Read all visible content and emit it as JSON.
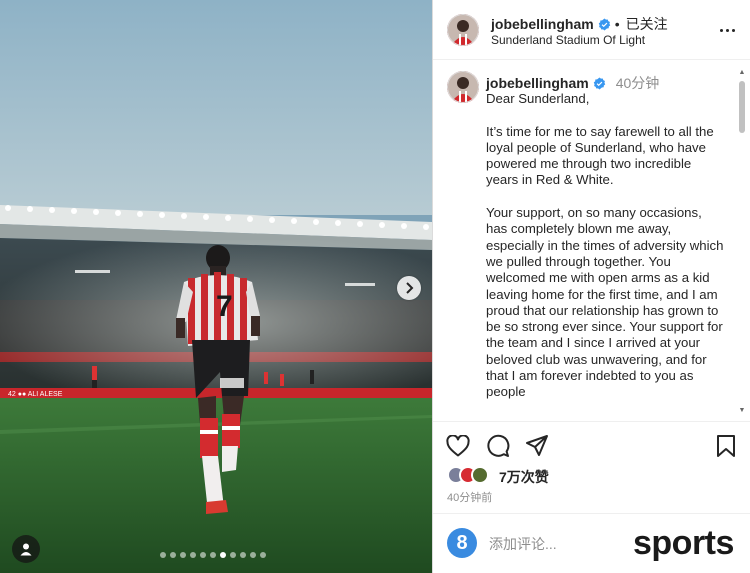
{
  "post": {
    "username": "jobebellingham",
    "follow_status": "已关注",
    "location": "Sunderland Stadium Of Light",
    "time_ago": "40分钟",
    "caption": {
      "greeting": "Dear Sunderland,",
      "paragraph_1": "It’s time for me to say farewell to all the loyal people of Sunderland, who have powered me through two incredible years in Red & White.",
      "paragraph_2": "Your support, on so many occasions, has completely blown me away, especially in the times of adversity which we pulled through together. You welcomed me with open arms as a kid leaving home for the first time, and I am proud that our relationship has grown to be so strong ever since. Your support for the team and I since I arrived at your beloved club was unwavering, and for that I am forever indebted to you as people"
    },
    "likes": "7万次赞",
    "posted": "40分钟前",
    "comment_placeholder": "添加评论...",
    "watermark": "sports"
  },
  "media": {
    "board_text": "42 ●● ALI ALESE",
    "shirt_number": "7",
    "carousel": {
      "total_slides": 11,
      "active_slide": 7
    }
  },
  "icons": {
    "verified": "verified-badge-icon",
    "more": "more-options-icon",
    "like": "heart-icon",
    "comment": "comment-bubble-icon",
    "share": "paper-plane-icon",
    "save": "bookmark-icon",
    "next": "chevron-right-icon",
    "tag": "user-tag-icon",
    "emoji": "emoji-icon"
  },
  "colors": {
    "verified": "#3897f0",
    "accent_red": "#d1262f",
    "text": "#262626",
    "muted": "#8e8e8e"
  }
}
